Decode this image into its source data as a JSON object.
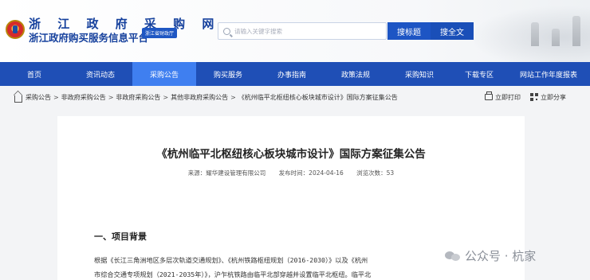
{
  "header": {
    "title": "浙 江 政 府 采 购 网",
    "subtitle": "浙江政府购买服务信息平台",
    "badge": "浙江省财政厅",
    "search_placeholder": "请输入关键字搜索",
    "search_title_btn": "搜标题",
    "search_full_btn": "搜全文"
  },
  "nav": {
    "items": [
      "首页",
      "资讯动态",
      "采购公告",
      "购买服务",
      "办事指南",
      "政策法规",
      "采购知识",
      "下载专区",
      "网站工作年度报表"
    ],
    "active_index": 2
  },
  "breadcrumb": {
    "items": [
      "采购公告",
      "非政府采购公告",
      "非政府采购公告",
      "其他非政府采购公告",
      "《杭州临平北枢纽核心板块城市设计》国际方案征集公告"
    ],
    "separator": ">"
  },
  "tools": {
    "print": "立即打印",
    "share": "立即分享"
  },
  "article": {
    "title": "《杭州临平北枢纽核心板块城市设计》国际方案征集公告",
    "source": "来源：耀华建设管理有限公司",
    "publish_time": "发布时间：2024-04-16",
    "views": "浏览次数：53",
    "section1_title": "一、项目背景",
    "para_line1": "根据《长江三角洲地区多层次轨道交通规划》、《杭州铁路枢纽规划（2016-2030）》以及《杭州",
    "para_line2": "市综合交通专项规划（2021-2035年）》，沪乍杭铁路由临平北部穿越并设置临平北枢纽。临平北"
  },
  "watermark": {
    "text": "公众号 · 杭家"
  },
  "colors": {
    "nav_bg": "#1f4fb6",
    "nav_active": "#3f7ff0",
    "brand_blue": "#16419d"
  }
}
